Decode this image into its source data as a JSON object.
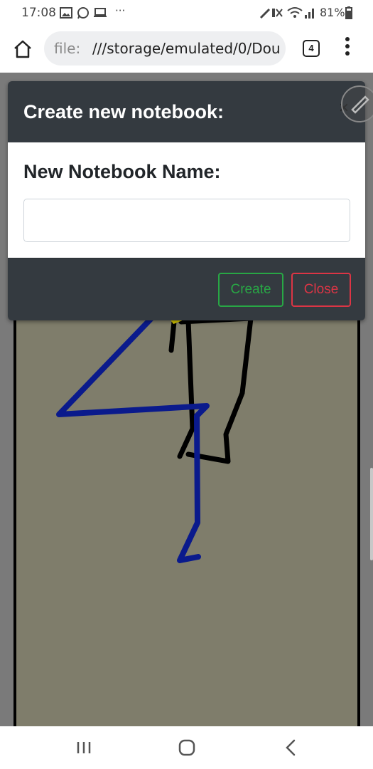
{
  "status_bar": {
    "time": "17:08",
    "battery": "81%",
    "more_indicator": "···",
    "icons": [
      "image-icon",
      "whatsapp-icon",
      "laptop-icon",
      "mute-icon",
      "wifi-icon",
      "signal-icon",
      "battery-icon"
    ]
  },
  "browser": {
    "url_scheme": "file:",
    "url_rest": "///storage/emulated/0/Dou",
    "tab_count": "4"
  },
  "modal": {
    "title": "Create new notebook:",
    "close_symbol": "×",
    "field_label": "New Notebook Name:",
    "input_value": "",
    "input_placeholder": "",
    "create_label": "Create",
    "close_label": "Close"
  },
  "colors": {
    "modal_header": "#343a40",
    "create_outline": "#28a745",
    "close_outline": "#dc3545",
    "canvas_bg": "#7f7d6b",
    "stroke_black": "#000000",
    "stroke_blue": "#0a1a8c"
  }
}
